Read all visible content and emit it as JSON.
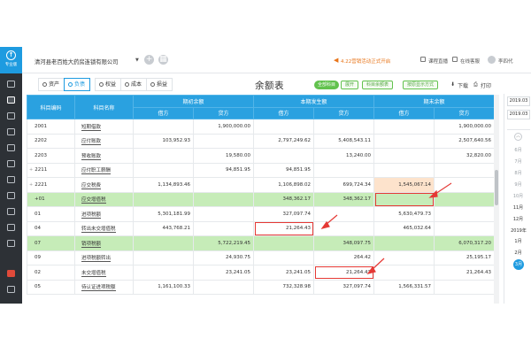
{
  "app": {
    "logo_text": "专业版",
    "company_name": "清河县老百姓大药房连锁有限公司",
    "notice": "4.22营销活动正式开启",
    "top_links": [
      "课程直播",
      "在线客服",
      "李四代"
    ]
  },
  "tabs": [
    {
      "label": "资产",
      "active": false
    },
    {
      "label": "负债",
      "active": true
    },
    {
      "label": "权益",
      "active": false
    },
    {
      "label": "成本",
      "active": false
    },
    {
      "label": "损益",
      "active": false
    }
  ],
  "page_title": "余额表",
  "toolbar": {
    "show_all": "全部科目",
    "btn1": "展开",
    "btn2": "科目余额表",
    "btn3": "按原显示方式",
    "download": "下载",
    "print": "打印"
  },
  "table": {
    "headers": {
      "code": "科目编码",
      "name": "科目名称",
      "opening": "期初余额",
      "current": "本期发生额",
      "closing": "期末余额",
      "debit": "借方",
      "credit": "贷方"
    },
    "rows": [
      {
        "mark": "",
        "code": "2001",
        "name": "短期借款",
        "ob_d": "",
        "ob_c": "1,900,000.00",
        "cur_d": "",
        "cur_c": "",
        "cl_d": "",
        "cl_c": "1,900,000.00"
      },
      {
        "mark": "",
        "code": "2202",
        "name": "应付账款",
        "ob_d": "103,952.93",
        "ob_c": "",
        "cur_d": "2,797,249.62",
        "cur_c": "5,408,543.11",
        "cl_d": "",
        "cl_c": "2,507,640.56"
      },
      {
        "mark": "",
        "code": "2203",
        "name": "预收账款",
        "ob_d": "",
        "ob_c": "19,580.00",
        "cur_d": "",
        "cur_c": "13,240.00",
        "cl_d": "",
        "cl_c": "32,820.00"
      },
      {
        "mark": "+",
        "code": "2211",
        "name": "应付职工薪酬",
        "ob_d": "",
        "ob_c": "94,851.95",
        "cur_d": "94,851.95",
        "cur_c": "",
        "cl_d": "",
        "cl_c": ""
      },
      {
        "mark": "+",
        "code": "2221",
        "name": "应交税费",
        "ob_d": "1,134,893.46",
        "ob_c": "",
        "cur_d": "1,106,898.02",
        "cur_c": "699,724.34",
        "cl_d": "1,545,067.14",
        "cl_c": ""
      },
      {
        "mark": "",
        "code": "+01",
        "name": "应交增值税",
        "ob_d": "",
        "ob_c": "",
        "cur_d": "348,362.17",
        "cur_c": "348,362.17",
        "cl_d": "",
        "cl_c": ""
      },
      {
        "mark": "",
        "code": "01",
        "name": "进项税额",
        "ob_d": "5,301,181.99",
        "ob_c": "",
        "cur_d": "327,097.74",
        "cur_c": "",
        "cl_d": "5,630,479.73",
        "cl_c": ""
      },
      {
        "mark": "",
        "code": "04",
        "name": "转出未交增值税",
        "ob_d": "443,768.21",
        "ob_c": "",
        "cur_d": "21,264.43",
        "cur_c": "",
        "cl_d": "465,032.64",
        "cl_c": ""
      },
      {
        "mark": "",
        "code": "07",
        "name": "销项税额",
        "ob_d": "",
        "ob_c": "5,722,219.45",
        "cur_d": "",
        "cur_c": "348,097.75",
        "cl_d": "",
        "cl_c": "6,070,317.20"
      },
      {
        "mark": "",
        "code": "09",
        "name": "进项税额转出",
        "ob_d": "",
        "ob_c": "24,930.75",
        "cur_d": "",
        "cur_c": "264.42",
        "cl_d": "",
        "cl_c": "25,195.17"
      },
      {
        "mark": "",
        "code": "02",
        "name": "未交增值税",
        "ob_d": "",
        "ob_c": "23,241.05",
        "cur_d": "23,241.05",
        "cur_c": "21,264.43",
        "cl_d": "",
        "cl_c": "21,264.43"
      },
      {
        "mark": "",
        "code": "05",
        "name": "待认证进项税额",
        "ob_d": "1,161,100.33",
        "ob_c": "",
        "cur_d": "732,328.98",
        "cur_c": "327,097.74",
        "cl_d": "1,566,331.57",
        "cl_c": ""
      }
    ]
  },
  "period_panel": {
    "start": "2019.03",
    "end": "2019.03",
    "months": [
      "6月",
      "7月",
      "8月",
      "9月",
      "10月",
      "11月",
      "12月"
    ],
    "year": "2019年",
    "months2": [
      "1月",
      "2月",
      "3月"
    ]
  },
  "colors": {
    "header_blue": "#2aa1e0",
    "highlight_green": "#c6ecb8",
    "sidebar_dark": "#2d3136",
    "annotation_red": "#e53935"
  }
}
